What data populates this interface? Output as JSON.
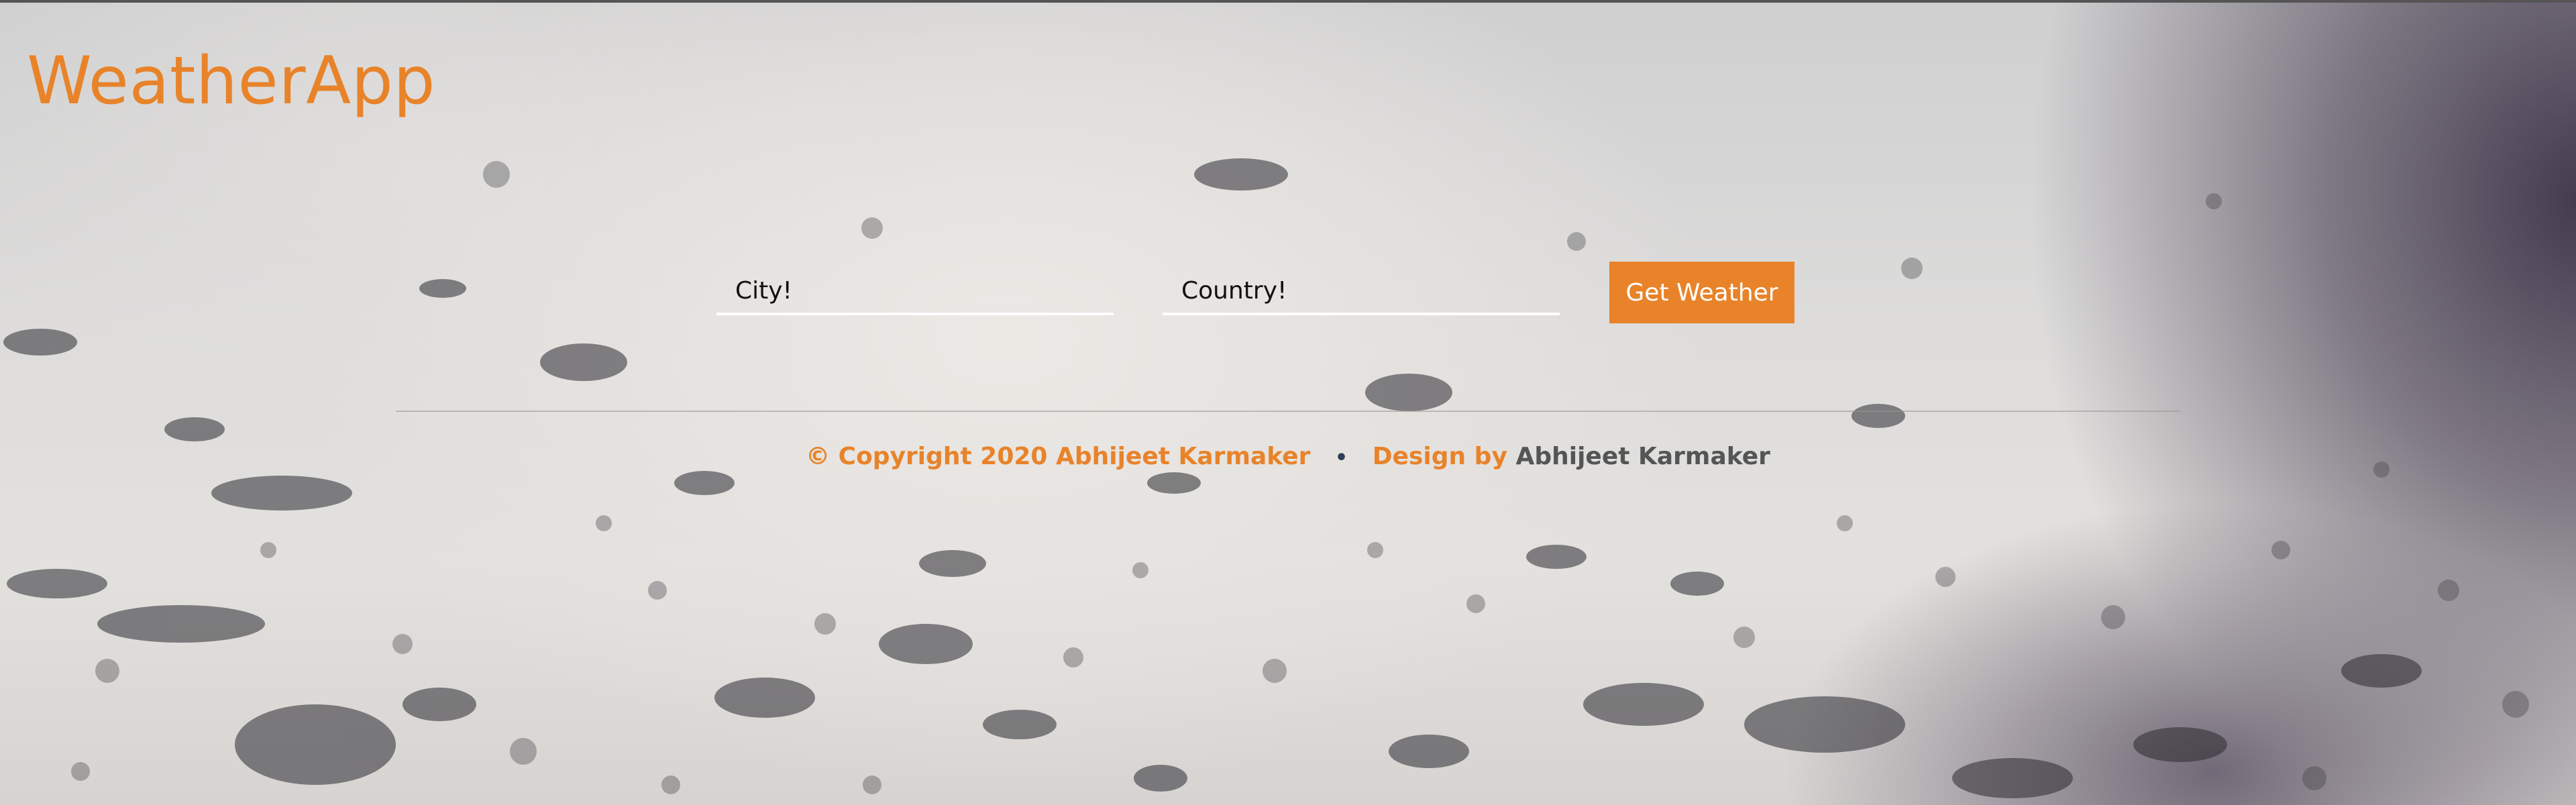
{
  "app": {
    "title": "WeatherApp"
  },
  "search": {
    "city_placeholder": "City!",
    "city_value": "",
    "country_placeholder": "Country!",
    "country_value": "",
    "button_label": "Get Weather"
  },
  "footer": {
    "copyright": "© Copyright 2020 Abhijeet Karmaker",
    "separator": "•",
    "design_by": "Design by",
    "designer": "Abhijeet Karmaker"
  },
  "colors": {
    "accent": "#e8832a",
    "footer_name": "#555555",
    "input_underline": "#ffffff"
  },
  "icons": {
    "separator": "bullet-icon"
  }
}
